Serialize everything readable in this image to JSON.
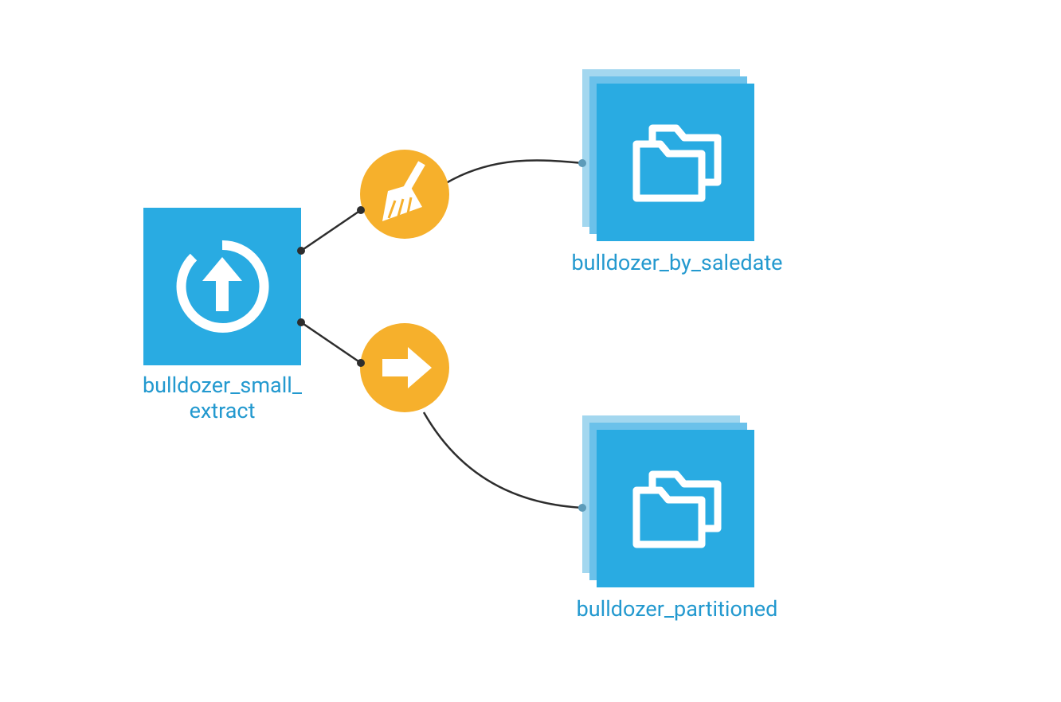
{
  "nodes": {
    "source": {
      "label": "bulldozer_small_\nextract",
      "icon": "upload-arrow"
    },
    "op_top": {
      "icon": "broom"
    },
    "op_bottom": {
      "icon": "arrow-right"
    },
    "output_top": {
      "label": "bulldozer_by_saledate",
      "icon": "folders"
    },
    "output_bottom": {
      "label": "bulldozer_partitioned",
      "icon": "folders"
    }
  },
  "colors": {
    "node_blue": "#29abe2",
    "op_yellow": "#f6b02c",
    "label_blue": "#2399cf"
  }
}
